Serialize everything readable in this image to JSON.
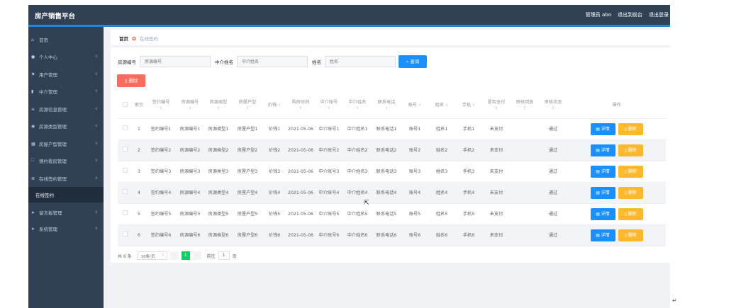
{
  "header": {
    "app_title": "房产销售平台",
    "admin_label": "管理员 abo",
    "back_label": "退出到前台",
    "logout_label": "退出登录"
  },
  "sidebar": {
    "items": [
      {
        "icon": "home-icon",
        "label": "首页",
        "chevron": false
      },
      {
        "icon": "user-icon",
        "label": "个人中心",
        "chevron": true
      },
      {
        "icon": "flag-icon",
        "label": "用户管理",
        "chevron": true
      },
      {
        "icon": "chart-icon",
        "label": "中介管理",
        "chevron": true
      },
      {
        "icon": "list-icon",
        "label": "房源信息管理",
        "chevron": true
      },
      {
        "icon": "pin-icon",
        "label": "房源类型管理",
        "chevron": true
      },
      {
        "icon": "grid-icon",
        "label": "房屋户型管理",
        "chevron": true
      },
      {
        "icon": "frame-icon",
        "label": "预约看房管理",
        "chevron": true
      },
      {
        "icon": "menu-icon",
        "label": "在线签约管理",
        "chevron": true,
        "expanded": true
      },
      {
        "icon": "send-icon",
        "label": "留言板管理",
        "chevron": true
      },
      {
        "icon": "send-icon",
        "label": "系统管理",
        "chevron": true
      }
    ],
    "subitem": "在线签约"
  },
  "breadcrumb": {
    "home": "首页",
    "current": "在线签约"
  },
  "search": {
    "house_no_label": "房源编号",
    "house_no_placeholder": "房源编号",
    "agent_label": "中介姓名",
    "agent_placeholder": "中介姓名",
    "name_label": "姓名",
    "name_placeholder": "姓名",
    "query_label": "查询"
  },
  "actions": {
    "delete_label": "删除"
  },
  "table": {
    "headers": [
      "索引",
      "签约编号",
      "房源编号",
      "房源类型",
      "房屋户型",
      "价钱",
      "购房时间",
      "中介账号",
      "中介姓名",
      "联系电话",
      "账号",
      "姓名",
      "手机",
      "是否支付",
      "审核回复",
      "审核状态",
      "操作"
    ],
    "rows": [
      {
        "index": "1",
        "contract": "签约编号1",
        "house": "房源编号1",
        "type": "房源类型1",
        "layout": "房屋户型1",
        "price": "价钱1",
        "date": "2021-05-06",
        "agent_acc": "中介账号1",
        "agent_name": "中介姓名1",
        "phone": "联系电话1",
        "account": "账号1",
        "name": "姓名1",
        "mobile": "手机1",
        "paid": "未支付",
        "reply": "",
        "status": "通过"
      },
      {
        "index": "2",
        "contract": "签约编号2",
        "house": "房源编号2",
        "type": "房源类型2",
        "layout": "房屋户型2",
        "price": "价钱2",
        "date": "2021-05-06",
        "agent_acc": "中介账号2",
        "agent_name": "中介姓名2",
        "phone": "联系电话2",
        "account": "账号2",
        "name": "姓名2",
        "mobile": "手机2",
        "paid": "未支付",
        "reply": "",
        "status": "通过"
      },
      {
        "index": "3",
        "contract": "签约编号3",
        "house": "房源编号3",
        "type": "房源类型3",
        "layout": "房屋户型3",
        "price": "价钱3",
        "date": "2021-05-06",
        "agent_acc": "中介账号3",
        "agent_name": "中介姓名3",
        "phone": "联系电话3",
        "account": "账号3",
        "name": "姓名3",
        "mobile": "手机3",
        "paid": "未支付",
        "reply": "",
        "status": "通过"
      },
      {
        "index": "4",
        "contract": "签约编号4",
        "house": "房源编号4",
        "type": "房源类型4",
        "layout": "房屋户型4",
        "price": "价钱4",
        "date": "2021-05-06",
        "agent_acc": "中介账号4",
        "agent_name": "中介姓名4",
        "phone": "联系电话4",
        "account": "账号4",
        "name": "姓名4",
        "mobile": "手机4",
        "paid": "未支付",
        "reply": "",
        "status": "通过"
      },
      {
        "index": "5",
        "contract": "签约编号5",
        "house": "房源编号5",
        "type": "房源类型5",
        "layout": "房屋户型5",
        "price": "价钱5",
        "date": "2021-05-06",
        "agent_acc": "中介账号5",
        "agent_name": "中介姓名5",
        "phone": "联系电话5",
        "account": "账号5",
        "name": "姓名5",
        "mobile": "手机5",
        "paid": "未支付",
        "reply": "",
        "status": "通过"
      },
      {
        "index": "6",
        "contract": "签约编号6",
        "house": "房源编号6",
        "type": "房源类型6",
        "layout": "房屋户型6",
        "price": "价钱6",
        "date": "2021-05-06",
        "agent_acc": "中介账号6",
        "agent_name": "中介姓名6",
        "phone": "联系电话6",
        "account": "账号6",
        "name": "姓名6",
        "mobile": "手机6",
        "paid": "未支付",
        "reply": "",
        "status": "通过"
      }
    ],
    "detail_label": "详情",
    "remove_label": "删除"
  },
  "pagination": {
    "total": "共 6 条",
    "page_size": "10条/页",
    "current_page": "1",
    "goto_prefix": "前往",
    "goto_value": "1",
    "goto_suffix": "页"
  },
  "colors": {
    "sidebar": "#304156",
    "accent": "#1e88e5",
    "primary": "#1890ff",
    "danger": "#ff6b5b",
    "warning": "#fdb92b",
    "success": "#13ce66"
  }
}
